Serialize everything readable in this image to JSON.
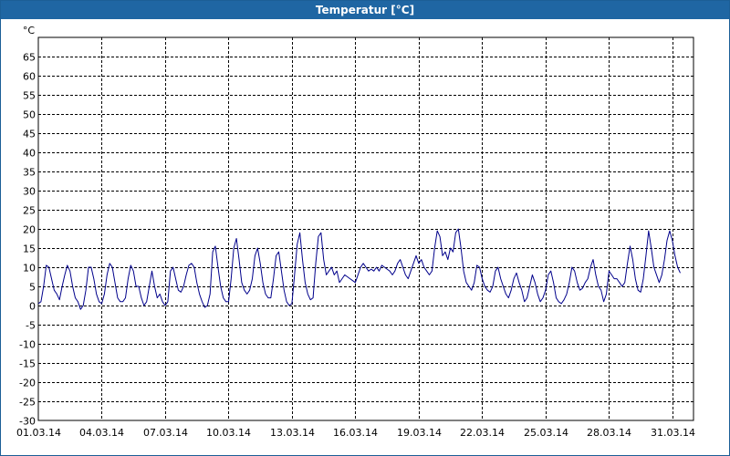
{
  "window": {
    "title": "Temperatur [°C]"
  },
  "colors": {
    "titlebar": "#1f66a3",
    "series": "#00008b",
    "grid": "#000000"
  },
  "chart_data": {
    "type": "line",
    "title": "Temperatur [°C]",
    "xlabel": "",
    "ylabel": "°C",
    "grid": true,
    "ylim": [
      -30,
      70
    ],
    "xlim": [
      "2014-03-01",
      "2014-04-01"
    ],
    "y_ticks": [
      -30,
      -25,
      -20,
      -15,
      -10,
      -5,
      0,
      5,
      10,
      15,
      20,
      25,
      30,
      35,
      40,
      45,
      50,
      55,
      60,
      65
    ],
    "x_ticks": [
      "01.03.14",
      "04.03.14",
      "07.03.14",
      "10.03.14",
      "13.03.14",
      "16.03.14",
      "19.03.14",
      "22.03.14",
      "25.03.14",
      "28.03.14",
      "31.03.14"
    ],
    "series": [
      {
        "name": "",
        "color": "#00008b",
        "points": [
          [
            "2014-03-01 00:00",
            0.5
          ],
          [
            "2014-03-01 03:00",
            1
          ],
          [
            "2014-03-01 06:00",
            5
          ],
          [
            "2014-03-01 09:00",
            10.5
          ],
          [
            "2014-03-01 12:00",
            10
          ],
          [
            "2014-03-01 15:00",
            7
          ],
          [
            "2014-03-01 18:00",
            4
          ],
          [
            "2014-03-01 21:00",
            3
          ],
          [
            "2014-03-02 00:00",
            1.5
          ],
          [
            "2014-03-02 03:00",
            5
          ],
          [
            "2014-03-02 06:00",
            8
          ],
          [
            "2014-03-02 09:00",
            10.5
          ],
          [
            "2014-03-02 12:00",
            9
          ],
          [
            "2014-03-02 15:00",
            5
          ],
          [
            "2014-03-02 18:00",
            2
          ],
          [
            "2014-03-02 21:00",
            1
          ],
          [
            "2014-03-03 00:00",
            -1
          ],
          [
            "2014-03-03 03:00",
            0
          ],
          [
            "2014-03-03 06:00",
            4
          ],
          [
            "2014-03-03 09:00",
            10
          ],
          [
            "2014-03-03 12:00",
            10
          ],
          [
            "2014-03-03 15:00",
            7
          ],
          [
            "2014-03-03 18:00",
            3
          ],
          [
            "2014-03-03 21:00",
            1
          ],
          [
            "2014-03-04 00:00",
            0.5
          ],
          [
            "2014-03-04 03:00",
            3
          ],
          [
            "2014-03-04 06:00",
            8
          ],
          [
            "2014-03-04 09:00",
            11
          ],
          [
            "2014-03-04 12:00",
            10
          ],
          [
            "2014-03-04 15:00",
            6
          ],
          [
            "2014-03-04 18:00",
            2
          ],
          [
            "2014-03-04 21:00",
            1
          ],
          [
            "2014-03-05 00:00",
            1
          ],
          [
            "2014-03-05 03:00",
            2
          ],
          [
            "2014-03-05 06:00",
            7
          ],
          [
            "2014-03-05 09:00",
            10.5
          ],
          [
            "2014-03-05 12:00",
            9
          ],
          [
            "2014-03-05 15:00",
            5
          ],
          [
            "2014-03-05 18:00",
            5
          ],
          [
            "2014-03-05 21:00",
            2
          ],
          [
            "2014-03-06 00:00",
            0
          ],
          [
            "2014-03-06 03:00",
            1
          ],
          [
            "2014-03-06 06:00",
            5
          ],
          [
            "2014-03-06 09:00",
            9
          ],
          [
            "2014-03-06 12:00",
            5
          ],
          [
            "2014-03-06 15:00",
            2
          ],
          [
            "2014-03-06 18:00",
            3
          ],
          [
            "2014-03-06 21:00",
            1
          ],
          [
            "2014-03-07 00:00",
            0
          ],
          [
            "2014-03-07 03:00",
            1
          ],
          [
            "2014-03-07 06:00",
            9
          ],
          [
            "2014-03-07 09:00",
            10
          ],
          [
            "2014-03-07 12:00",
            7
          ],
          [
            "2014-03-07 15:00",
            4
          ],
          [
            "2014-03-07 18:00",
            3.5
          ],
          [
            "2014-03-07 21:00",
            5
          ],
          [
            "2014-03-08 00:00",
            8
          ],
          [
            "2014-03-08 03:00",
            10.5
          ],
          [
            "2014-03-08 06:00",
            11
          ],
          [
            "2014-03-08 09:00",
            10
          ],
          [
            "2014-03-08 12:00",
            6
          ],
          [
            "2014-03-08 15:00",
            3
          ],
          [
            "2014-03-08 18:00",
            1
          ],
          [
            "2014-03-08 21:00",
            -0.5
          ],
          [
            "2014-03-09 00:00",
            0
          ],
          [
            "2014-03-09 03:00",
            3
          ],
          [
            "2014-03-09 06:00",
            14
          ],
          [
            "2014-03-09 09:00",
            15.5
          ],
          [
            "2014-03-09 12:00",
            10
          ],
          [
            "2014-03-09 15:00",
            5
          ],
          [
            "2014-03-09 18:00",
            2
          ],
          [
            "2014-03-09 21:00",
            1
          ],
          [
            "2014-03-10 00:00",
            1
          ],
          [
            "2014-03-10 03:00",
            7
          ],
          [
            "2014-03-10 06:00",
            15
          ],
          [
            "2014-03-10 09:00",
            17.5
          ],
          [
            "2014-03-10 12:00",
            12
          ],
          [
            "2014-03-10 15:00",
            6
          ],
          [
            "2014-03-10 18:00",
            4
          ],
          [
            "2014-03-10 21:00",
            3
          ],
          [
            "2014-03-11 00:00",
            4
          ],
          [
            "2014-03-11 03:00",
            7
          ],
          [
            "2014-03-11 06:00",
            13
          ],
          [
            "2014-03-11 09:00",
            15
          ],
          [
            "2014-03-11 12:00",
            11
          ],
          [
            "2014-03-11 15:00",
            6
          ],
          [
            "2014-03-11 18:00",
            3
          ],
          [
            "2014-03-11 21:00",
            2
          ],
          [
            "2014-03-12 00:00",
            2
          ],
          [
            "2014-03-12 03:00",
            7
          ],
          [
            "2014-03-12 06:00",
            13
          ],
          [
            "2014-03-12 09:00",
            14
          ],
          [
            "2014-03-12 12:00",
            9
          ],
          [
            "2014-03-12 15:00",
            4
          ],
          [
            "2014-03-12 18:00",
            1
          ],
          [
            "2014-03-12 21:00",
            0
          ],
          [
            "2014-03-13 00:00",
            0.5
          ],
          [
            "2014-03-13 03:00",
            8
          ],
          [
            "2014-03-13 06:00",
            16
          ],
          [
            "2014-03-13 09:00",
            19
          ],
          [
            "2014-03-13 12:00",
            12
          ],
          [
            "2014-03-13 15:00",
            6
          ],
          [
            "2014-03-13 18:00",
            3
          ],
          [
            "2014-03-13 21:00",
            1.5
          ],
          [
            "2014-03-14 00:00",
            2
          ],
          [
            "2014-03-14 03:00",
            11
          ],
          [
            "2014-03-14 06:00",
            18
          ],
          [
            "2014-03-14 09:00",
            19
          ],
          [
            "2014-03-14 12:00",
            12
          ],
          [
            "2014-03-14 15:00",
            8
          ],
          [
            "2014-03-14 18:00",
            9
          ],
          [
            "2014-03-14 21:00",
            10
          ],
          [
            "2014-03-15 00:00",
            8
          ],
          [
            "2014-03-15 03:00",
            9
          ],
          [
            "2014-03-15 06:00",
            6
          ],
          [
            "2014-03-15 09:00",
            7
          ],
          [
            "2014-03-15 12:00",
            8
          ],
          [
            "2014-03-15 15:00",
            7.5
          ],
          [
            "2014-03-15 18:00",
            7
          ],
          [
            "2014-03-15 21:00",
            6.5
          ],
          [
            "2014-03-16 00:00",
            6
          ],
          [
            "2014-03-16 03:00",
            8
          ],
          [
            "2014-03-16 06:00",
            10
          ],
          [
            "2014-03-16 09:00",
            11
          ],
          [
            "2014-03-16 12:00",
            10
          ],
          [
            "2014-03-16 15:00",
            9
          ],
          [
            "2014-03-16 18:00",
            9.5
          ],
          [
            "2014-03-16 21:00",
            9
          ],
          [
            "2014-03-17 00:00",
            10
          ],
          [
            "2014-03-17 03:00",
            9
          ],
          [
            "2014-03-17 06:00",
            10.5
          ],
          [
            "2014-03-17 09:00",
            10
          ],
          [
            "2014-03-17 12:00",
            9.5
          ],
          [
            "2014-03-17 15:00",
            9
          ],
          [
            "2014-03-17 18:00",
            8
          ],
          [
            "2014-03-17 21:00",
            9
          ],
          [
            "2014-03-18 00:00",
            11
          ],
          [
            "2014-03-18 03:00",
            12
          ],
          [
            "2014-03-18 06:00",
            10
          ],
          [
            "2014-03-18 09:00",
            8
          ],
          [
            "2014-03-18 12:00",
            7
          ],
          [
            "2014-03-18 15:00",
            9
          ],
          [
            "2014-03-18 18:00",
            11
          ],
          [
            "2014-03-18 21:00",
            13
          ],
          [
            "2014-03-19 00:00",
            11
          ],
          [
            "2014-03-19 03:00",
            12
          ],
          [
            "2014-03-19 06:00",
            10
          ],
          [
            "2014-03-19 09:00",
            9
          ],
          [
            "2014-03-19 12:00",
            8
          ],
          [
            "2014-03-19 15:00",
            9
          ],
          [
            "2014-03-19 18:00",
            15
          ],
          [
            "2014-03-19 21:00",
            19.5
          ],
          [
            "2014-03-20 00:00",
            18
          ],
          [
            "2014-03-20 03:00",
            13
          ],
          [
            "2014-03-20 06:00",
            14
          ],
          [
            "2014-03-20 09:00",
            12
          ],
          [
            "2014-03-20 12:00",
            15
          ],
          [
            "2014-03-20 15:00",
            14
          ],
          [
            "2014-03-20 18:00",
            19
          ],
          [
            "2014-03-20 21:00",
            20
          ],
          [
            "2014-03-21 00:00",
            15
          ],
          [
            "2014-03-21 03:00",
            9
          ],
          [
            "2014-03-21 06:00",
            6
          ],
          [
            "2014-03-21 09:00",
            5
          ],
          [
            "2014-03-21 12:00",
            4
          ],
          [
            "2014-03-21 15:00",
            6
          ],
          [
            "2014-03-21 18:00",
            10.5
          ],
          [
            "2014-03-21 21:00",
            10
          ],
          [
            "2014-03-22 00:00",
            7
          ],
          [
            "2014-03-22 03:00",
            5
          ],
          [
            "2014-03-22 06:00",
            4
          ],
          [
            "2014-03-22 09:00",
            3.5
          ],
          [
            "2014-03-22 12:00",
            5
          ],
          [
            "2014-03-22 15:00",
            9
          ],
          [
            "2014-03-22 18:00",
            10
          ],
          [
            "2014-03-22 21:00",
            7
          ],
          [
            "2014-03-23 00:00",
            5
          ],
          [
            "2014-03-23 03:00",
            3
          ],
          [
            "2014-03-23 06:00",
            2
          ],
          [
            "2014-03-23 09:00",
            4
          ],
          [
            "2014-03-23 12:00",
            7
          ],
          [
            "2014-03-23 15:00",
            8.5
          ],
          [
            "2014-03-23 18:00",
            6
          ],
          [
            "2014-03-23 21:00",
            4
          ],
          [
            "2014-03-24 00:00",
            1
          ],
          [
            "2014-03-24 03:00",
            2
          ],
          [
            "2014-03-24 06:00",
            5
          ],
          [
            "2014-03-24 09:00",
            8
          ],
          [
            "2014-03-24 12:00",
            6
          ],
          [
            "2014-03-24 15:00",
            3
          ],
          [
            "2014-03-24 18:00",
            1
          ],
          [
            "2014-03-24 21:00",
            2
          ],
          [
            "2014-03-25 00:00",
            4
          ],
          [
            "2014-03-25 03:00",
            8
          ],
          [
            "2014-03-25 06:00",
            9
          ],
          [
            "2014-03-25 09:00",
            6
          ],
          [
            "2014-03-25 12:00",
            2
          ],
          [
            "2014-03-25 15:00",
            1
          ],
          [
            "2014-03-25 18:00",
            0.5
          ],
          [
            "2014-03-25 21:00",
            1.5
          ],
          [
            "2014-03-26 00:00",
            3
          ],
          [
            "2014-03-26 03:00",
            6
          ],
          [
            "2014-03-26 06:00",
            10
          ],
          [
            "2014-03-26 09:00",
            9
          ],
          [
            "2014-03-26 12:00",
            6
          ],
          [
            "2014-03-26 15:00",
            4
          ],
          [
            "2014-03-26 18:00",
            4.5
          ],
          [
            "2014-03-26 21:00",
            6
          ],
          [
            "2014-03-27 00:00",
            7
          ],
          [
            "2014-03-27 03:00",
            10
          ],
          [
            "2014-03-27 06:00",
            12
          ],
          [
            "2014-03-27 09:00",
            8
          ],
          [
            "2014-03-27 12:00",
            5
          ],
          [
            "2014-03-27 15:00",
            4
          ],
          [
            "2014-03-27 18:00",
            1
          ],
          [
            "2014-03-27 21:00",
            3
          ],
          [
            "2014-03-28 00:00",
            9
          ],
          [
            "2014-03-28 03:00",
            8
          ],
          [
            "2014-03-28 06:00",
            7
          ],
          [
            "2014-03-28 09:00",
            7
          ],
          [
            "2014-03-28 12:00",
            6
          ],
          [
            "2014-03-28 15:00",
            5
          ],
          [
            "2014-03-28 18:00",
            6
          ],
          [
            "2014-03-28 21:00",
            11
          ],
          [
            "2014-03-29 00:00",
            15.5
          ],
          [
            "2014-03-29 03:00",
            12
          ],
          [
            "2014-03-29 06:00",
            7
          ],
          [
            "2014-03-29 09:00",
            4
          ],
          [
            "2014-03-29 12:00",
            3.5
          ],
          [
            "2014-03-29 15:00",
            7
          ],
          [
            "2014-03-29 18:00",
            13
          ],
          [
            "2014-03-29 21:00",
            19.5
          ],
          [
            "2014-03-30 00:00",
            15
          ],
          [
            "2014-03-30 03:00",
            10
          ],
          [
            "2014-03-30 06:00",
            8
          ],
          [
            "2014-03-30 09:00",
            6
          ],
          [
            "2014-03-30 12:00",
            8
          ],
          [
            "2014-03-30 15:00",
            12
          ],
          [
            "2014-03-30 18:00",
            17
          ],
          [
            "2014-03-30 21:00",
            19.5
          ],
          [
            "2014-03-31 00:00",
            17
          ],
          [
            "2014-03-31 03:00",
            13
          ],
          [
            "2014-03-31 06:00",
            10
          ],
          [
            "2014-03-31 09:00",
            8.5
          ]
        ]
      }
    ]
  }
}
